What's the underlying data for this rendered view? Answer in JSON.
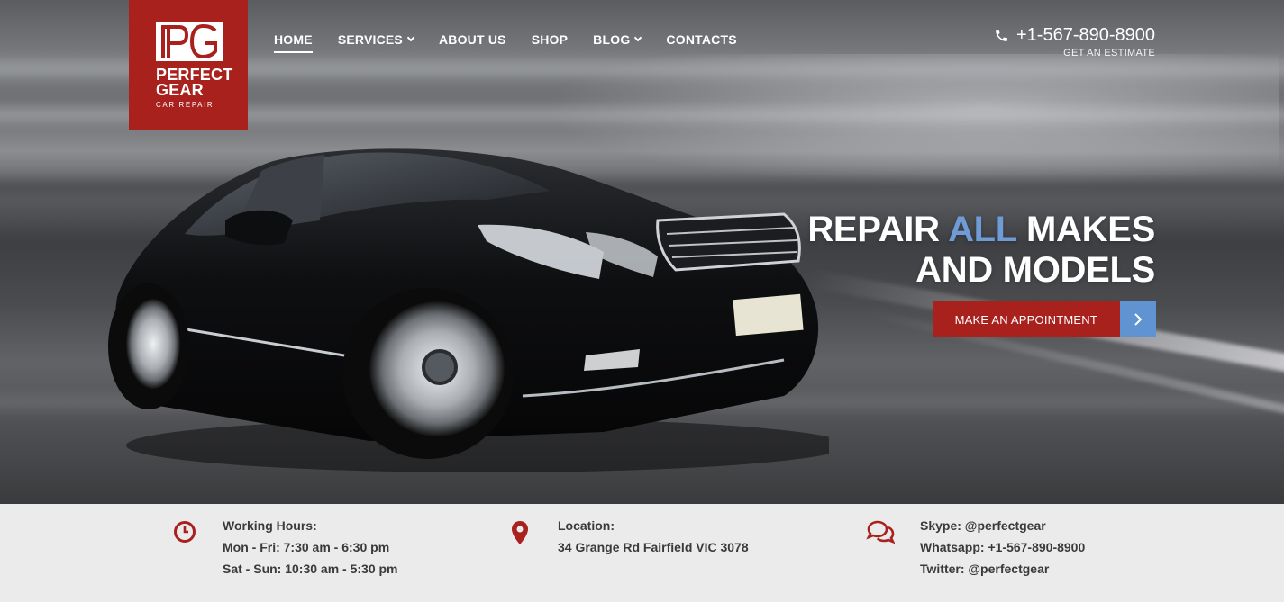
{
  "logo": {
    "name_line1": "PERFECT",
    "name_line2": "GEAR",
    "tagline": "CAR REPAIR",
    "brand_color": "#a8211d"
  },
  "nav": {
    "items": [
      {
        "label": "HOME",
        "active": true,
        "has_dropdown": false
      },
      {
        "label": "SERVICES",
        "active": false,
        "has_dropdown": true
      },
      {
        "label": "ABOUT US",
        "active": false,
        "has_dropdown": false
      },
      {
        "label": "SHOP",
        "active": false,
        "has_dropdown": false
      },
      {
        "label": "BLOG",
        "active": false,
        "has_dropdown": true
      },
      {
        "label": "CONTACTS",
        "active": false,
        "has_dropdown": false
      }
    ]
  },
  "phone": {
    "number": "+1-567-890-8900",
    "subtitle": "GET AN ESTIMATE",
    "icon": "phone-icon"
  },
  "hero": {
    "headline_word1": "REPAIR",
    "headline_accent": "ALL",
    "headline_word3": "MAKES",
    "headline_line2": "AND MODELS",
    "accent_color": "#6f9bd6",
    "cta_label": "MAKE AN APPOINTMENT",
    "cta_icon": "chevron-right-icon"
  },
  "info": {
    "hours": {
      "icon": "clock-icon",
      "title": "Working Hours:",
      "line1": "Mon - Fri: 7:30 am - 6:30 pm",
      "line2": "Sat - Sun: 10:30 am - 5:30 pm"
    },
    "location": {
      "icon": "map-pin-icon",
      "title": "Location:",
      "line1": "34 Grange Rd Fairfield VIC 3078"
    },
    "contact": {
      "icon": "chat-icon",
      "line1": "Skype: @perfectgear",
      "line2": "Whatsapp: +1-567-890-8900",
      "line3": "Twitter: @perfectgear"
    }
  }
}
